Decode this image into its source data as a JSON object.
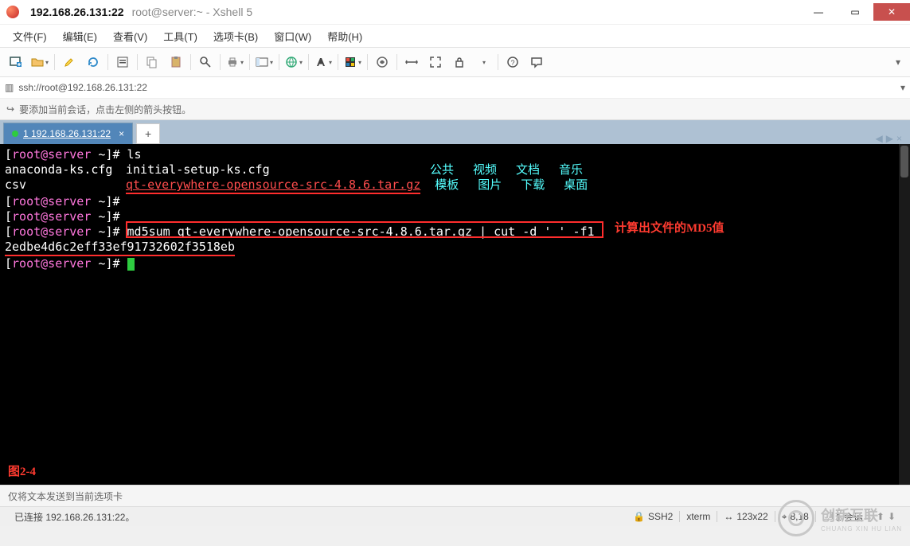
{
  "titlebar": {
    "ip": "192.168.26.131:22",
    "subtitle": "root@server:~ - Xshell 5"
  },
  "window_controls": {
    "min": "—",
    "max": "▭",
    "close": "✕"
  },
  "menu": {
    "file": "文件(F)",
    "edit": "编辑(E)",
    "view": "查看(V)",
    "tools": "工具(T)",
    "tabs": "选项卡(B)",
    "window": "窗口(W)",
    "help": "帮助(H)"
  },
  "toolbar_dropdown_indicator": "▾",
  "addressbar": {
    "url": "ssh://root@192.168.26.131:22"
  },
  "hintbar": {
    "text": "要添加当前会话，点击左侧的箭头按钮。"
  },
  "tabs": {
    "items": [
      {
        "label": "1 192.168.26.131:22"
      }
    ],
    "add": "+"
  },
  "terminal": {
    "prompt_open": "[",
    "prompt_user": "root@server",
    "prompt_path": " ~",
    "prompt_close": "]# ",
    "cmd_ls": "ls",
    "row1": {
      "c1": "anaconda-ks.cfg",
      "c2": "initial-setup-ks.cfg",
      "d1": "公共",
      "d2": "视频",
      "d3": "文档",
      "d4": "音乐"
    },
    "row2": {
      "c1": "csv",
      "c2": "qt-everywhere-opensource-src-4.8.6.tar.gz",
      "d1": "模板",
      "d2": "图片",
      "d3": "下载",
      "d4": "桌面"
    },
    "cmd_md5": "md5sum qt-everywhere-opensource-src-4.8.6.tar.gz | cut -d ' ' -f1",
    "md5_output": "2edbe4d6c2eff33ef91732602f3518eb",
    "annotation_md5": "计算出文件的MD5值",
    "figure_label": "图2-4"
  },
  "footer1": {
    "text": "仅将文本发送到当前选项卡"
  },
  "footer2": {
    "status": "已连接 192.168.26.131:22。",
    "ssh_icon": "🔒",
    "ssh": "SSH2",
    "term": "xterm",
    "size_icon": "↔",
    "size": "123x22",
    "cursor_icon": "⌖",
    "cursor_pos": "8,18",
    "sessions": "1 会话",
    "sessions_icon": "🗔",
    "updown1": "⬆",
    "updown2": "⬇"
  },
  "watermark": {
    "brand": "创新互联",
    "sub": "CHUANG XIN HU LIAN"
  },
  "colors": {
    "accent_close": "#c8504e",
    "tab_bg": "#5286b9",
    "term_bg": "#000000"
  }
}
